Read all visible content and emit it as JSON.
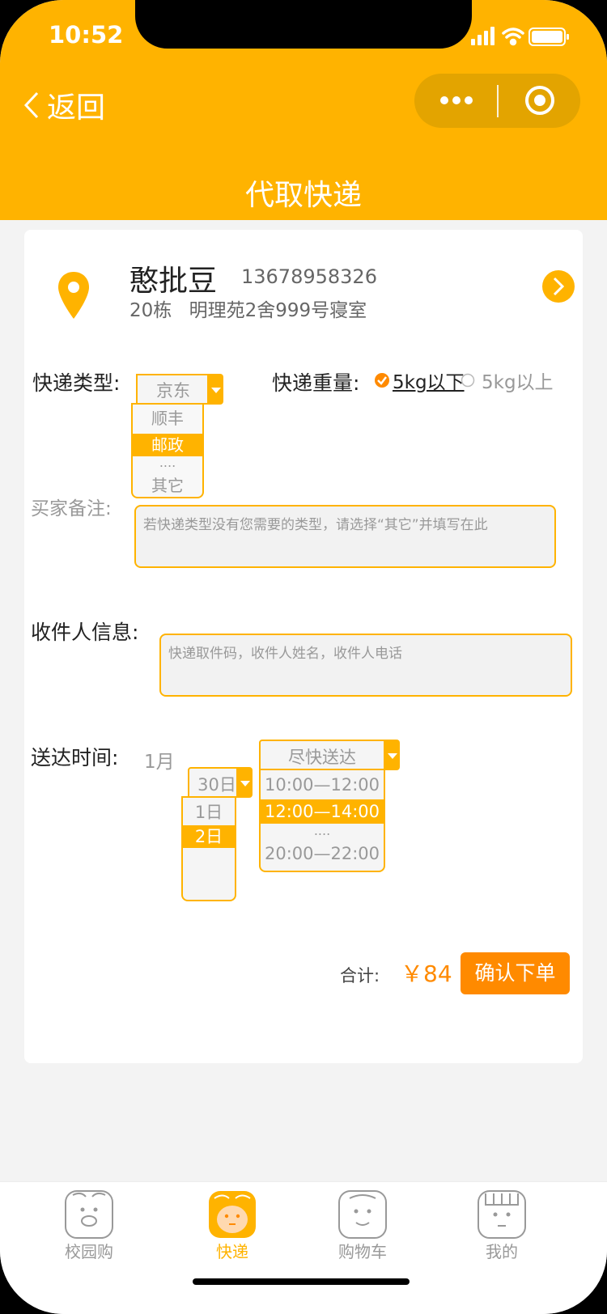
{
  "status": {
    "time": "10:52"
  },
  "nav": {
    "back_label": "返回",
    "title": "代取快递"
  },
  "address": {
    "name": "憨批豆",
    "phone": "13678958326",
    "building": "20栋",
    "detail": "明理苑2舍999号寝室"
  },
  "express_type": {
    "label": "快递类型:",
    "selected": "京东",
    "options": [
      "顺丰",
      "邮政",
      "....",
      "其它"
    ],
    "highlighted": "邮政"
  },
  "weight": {
    "label": "快递重量:",
    "options": [
      {
        "label": "5kg以下",
        "checked": true
      },
      {
        "label": "5kg以上",
        "checked": false
      }
    ]
  },
  "remark": {
    "label": "买家备注:",
    "placeholder": "若快递类型没有您需要的类型，请选择“其它”并填写在此"
  },
  "receiver": {
    "label": "收件人信息:",
    "placeholder": "快递取件码，收件人姓名，收件人电话"
  },
  "delivery": {
    "label": "送达时间:",
    "month": "1月",
    "day_selected": "30日",
    "day_options": [
      "1日",
      "2日"
    ],
    "day_highlighted": "2日",
    "slot_selected": "尽快送达",
    "slot_options": [
      "10:00—12:00",
      "12:00—14:00",
      "....",
      "20:00—22:00"
    ],
    "slot_highlighted": "12:00—14:00"
  },
  "total": {
    "label": "合计:",
    "amount": "￥84"
  },
  "submit_label": "确认下单",
  "tabs": [
    {
      "label": "校园购",
      "active": false
    },
    {
      "label": "快递",
      "active": true
    },
    {
      "label": "购物车",
      "active": false
    },
    {
      "label": "我的",
      "active": false
    }
  ],
  "colors": {
    "accent": "#ffb300",
    "button": "#ff8a00",
    "price": "#ff8a00"
  }
}
